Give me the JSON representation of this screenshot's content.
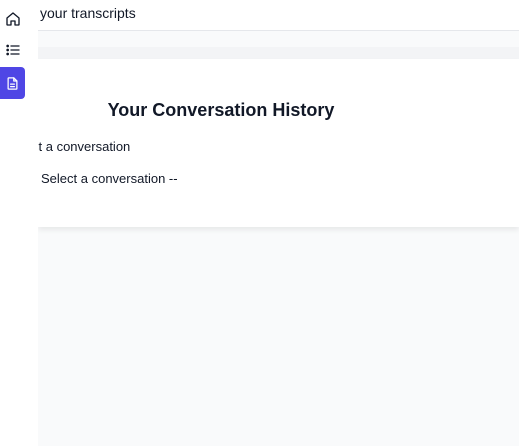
{
  "sidebar": {
    "items": [
      {
        "icon": "home-icon"
      },
      {
        "icon": "list-icon"
      },
      {
        "icon": "document-icon",
        "active": true
      }
    ]
  },
  "header": {
    "title": "your transcripts"
  },
  "card": {
    "title": "Your Conversation History",
    "field_label": "ct a conversation",
    "select_value": "Select a conversation --"
  },
  "colors": {
    "accent": "#4f46e5",
    "background": "#f9fafb"
  }
}
